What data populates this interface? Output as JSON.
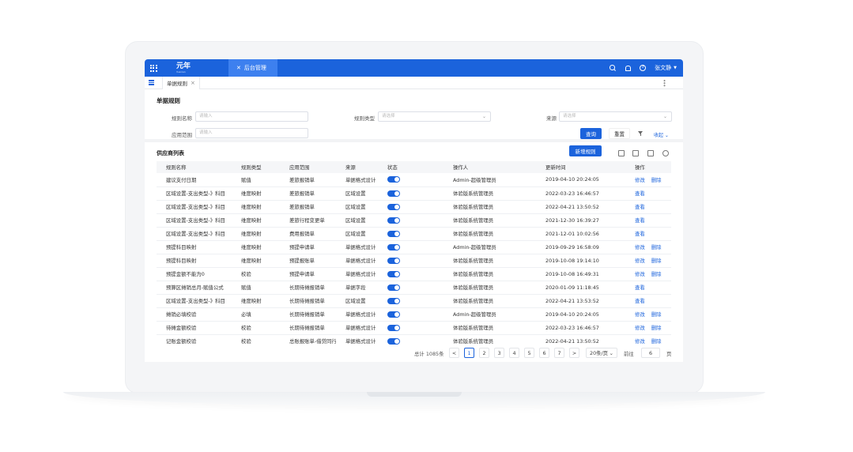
{
  "topbar": {
    "logo_main": "元年",
    "logo_sub": "Yuanian",
    "nav_tab": "后台管理",
    "user_name": "张文静",
    "help_glyph": "?"
  },
  "tabbar": {
    "page_tab": "单据规则",
    "close_glyph": "×"
  },
  "filter": {
    "title": "单据规则",
    "fields": [
      {
        "label": "规则名称",
        "placeholder": "请输入"
      },
      {
        "label": "规则类型",
        "placeholder": "请选择"
      },
      {
        "label": "来源",
        "placeholder": "请选择"
      },
      {
        "label": "应用范围",
        "placeholder": "请输入"
      }
    ],
    "query_label": "查询",
    "reset_label": "重置",
    "collapse_label": "收起"
  },
  "list": {
    "title": "供应商列表",
    "add_label": "新增规则",
    "columns": [
      "规则名称",
      "规则类型",
      "应用范围",
      "来源",
      "状态",
      "操作人",
      "更新时间",
      "操作"
    ],
    "rows": [
      {
        "name": "建议支付日期",
        "type": "赋值",
        "scope": "差旅报销单",
        "source": "单据格式设计",
        "operator": "Admin-超级管理员",
        "time": "2019-04-10  20:24:05",
        "actions": [
          "修改",
          "删除"
        ]
      },
      {
        "name": "区域设置-支出类型-》科目",
        "type": "维度映射",
        "scope": "差旅报销单",
        "source": "区域设置",
        "operator": "体验版系统管理员",
        "time": "2022-03-23  16:46:57",
        "actions": [
          "查看"
        ]
      },
      {
        "name": "区域设置-支出类型-》科目",
        "type": "维度映射",
        "scope": "差旅报销单",
        "source": "区域设置",
        "operator": "体验版系统管理员",
        "time": "2022-04-21  13:50:52",
        "actions": [
          "查看"
        ]
      },
      {
        "name": "区域设置-支出类型-》科目",
        "type": "维度映射",
        "scope": "差旅行程变更单",
        "source": "区域设置",
        "operator": "体验版系统管理员",
        "time": "2021-12-30  16:39:27",
        "actions": [
          "查看"
        ]
      },
      {
        "name": "区域设置-支出类型-》科目",
        "type": "维度映射",
        "scope": "费用报销单",
        "source": "区域设置",
        "operator": "体验版系统管理员",
        "time": "2021-12-01  10:02:56",
        "actions": [
          "查看"
        ]
      },
      {
        "name": "预提科目映射",
        "type": "维度映射",
        "scope": "预提申请单",
        "source": "单据格式设计",
        "operator": "Admin-超级管理员",
        "time": "2019-09-29  16:58:09",
        "actions": [
          "修改",
          "删除"
        ]
      },
      {
        "name": "预提科目映射",
        "type": "维度映射",
        "scope": "预提报账单",
        "source": "单据格式设计",
        "operator": "体验版系统管理员",
        "time": "2019-10-08  19:14:10",
        "actions": [
          "修改",
          "删除"
        ]
      },
      {
        "name": "预提金额不能为0",
        "type": "校验",
        "scope": "预提申请单",
        "source": "单据格式设计",
        "operator": "体验版系统管理员",
        "time": "2019-10-08  16:49:31",
        "actions": [
          "修改",
          "删除"
        ]
      },
      {
        "name": "预算区摊销总月-赋值公式",
        "type": "赋值",
        "scope": "长期待摊报销单",
        "source": "单据字段",
        "operator": "体验版系统管理员",
        "time": "2020-01-09  11:18:45",
        "actions": [
          "查看"
        ]
      },
      {
        "name": "区域设置-支出类型-》科目",
        "type": "维度映射",
        "scope": "长期待摊报销单",
        "source": "区域设置",
        "operator": "体验版系统管理员",
        "time": "2022-04-21  13:53:52",
        "actions": [
          "查看"
        ]
      },
      {
        "name": "摊销必填校验",
        "type": "必填",
        "scope": "长期待摊报销单",
        "source": "单据格式设计",
        "operator": "Admin-超级管理员",
        "time": "2019-04-10  20:24:05",
        "actions": [
          "修改",
          "删除"
        ]
      },
      {
        "name": "待摊金额校验",
        "type": "校验",
        "scope": "长期待摊报销单",
        "source": "单据格式设计",
        "operator": "体验版系统管理员",
        "time": "2022-03-23  16:46:57",
        "actions": [
          "修改",
          "删除"
        ]
      },
      {
        "name": "记账金额校验",
        "type": "校验",
        "scope": "总账报账单-借贷同行",
        "source": "单据格式设计",
        "operator": "体验版系统管理员",
        "time": "2022-04-21  13:50:52",
        "actions": [
          "修改",
          "删除"
        ]
      }
    ]
  },
  "pager": {
    "total": "总计 1085条",
    "prev": "<",
    "next": ">",
    "pages": [
      "1",
      "2",
      "3",
      "4",
      "5",
      "6",
      "7"
    ],
    "current": "1",
    "page_size": "20条/页",
    "goto_label": "前往",
    "goto_value": "6",
    "page_suffix": "页"
  },
  "colors": {
    "primary": "#1b63dc",
    "tab_active": "#3d80ef"
  }
}
